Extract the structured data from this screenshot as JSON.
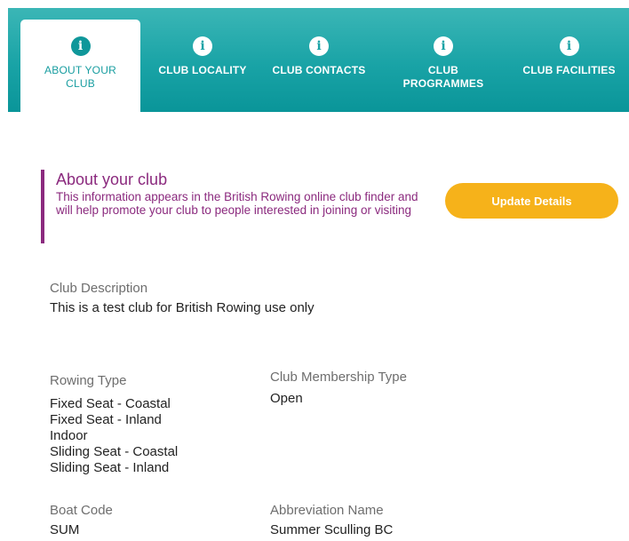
{
  "tabs": [
    {
      "label": "ABOUT YOUR CLUB",
      "icon": "info-icon",
      "active": true
    },
    {
      "label": "CLUB LOCALITY",
      "icon": "info-icon",
      "active": false
    },
    {
      "label": "CLUB CONTACTS",
      "icon": "info-icon",
      "active": false
    },
    {
      "label": "CLUB PROGRAMMES",
      "icon": "info-icon",
      "active": false
    },
    {
      "label": "CLUB FACILITIES",
      "icon": "info-icon",
      "active": false
    }
  ],
  "info_glyph": "i",
  "intro": {
    "title": "About your club",
    "description": "This information appears in the British Rowing online club finder and will help promote your club to people interested in joining or visiting"
  },
  "update_button": {
    "label": "Update Details"
  },
  "club_description": {
    "label": "Club Description",
    "value": "This is a test club for British Rowing use only"
  },
  "rowing_type": {
    "label": "Rowing Type",
    "values": [
      "Fixed Seat - Coastal",
      "Fixed Seat - Inland",
      "Indoor",
      "Sliding Seat - Coastal",
      "Sliding Seat - Inland"
    ]
  },
  "membership_type": {
    "label": "Club Membership Type",
    "value": "Open"
  },
  "boat_code": {
    "label": "Boat Code",
    "value": "SUM"
  },
  "abbreviation": {
    "label": "Abbreviation Name",
    "value": "Summer Sculling BC"
  },
  "colors": {
    "tab_bar": "#19a3a6",
    "accent_purple": "#8b2a7e",
    "button_yellow": "#f6b21a"
  }
}
